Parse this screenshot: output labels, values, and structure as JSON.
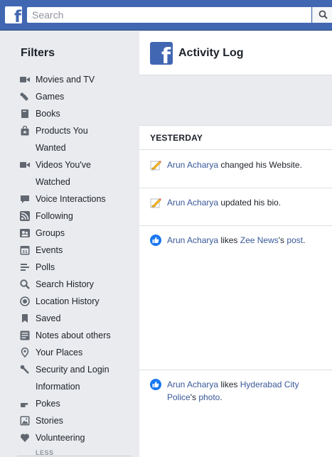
{
  "search": {
    "placeholder": "Search"
  },
  "sidebar": {
    "title": "Filters",
    "items": [
      {
        "label": "Movies and TV"
      },
      {
        "label": "Games"
      },
      {
        "label": "Books"
      },
      {
        "label": "Products You"
      },
      {
        "label": "Wanted"
      },
      {
        "label": "Videos You've"
      },
      {
        "label": "Watched"
      },
      {
        "label": "Voice Interactions"
      },
      {
        "label": "Following"
      },
      {
        "label": "Groups"
      },
      {
        "label": "Events"
      },
      {
        "label": "Polls"
      },
      {
        "label": "Search History"
      },
      {
        "label": "Location History"
      },
      {
        "label": "Saved"
      },
      {
        "label": "Notes about others"
      },
      {
        "label": "Your Places"
      },
      {
        "label": "Security and Login"
      },
      {
        "label": "Information"
      },
      {
        "label": "Pokes"
      },
      {
        "label": "Stories"
      },
      {
        "label": "Volunteering"
      }
    ],
    "less_label": "LESS"
  },
  "header": {
    "title": "Activity Log"
  },
  "feed": {
    "day_label": "YESTERDAY",
    "entries": [
      {
        "actor": "Arun Acharya",
        "action": " changed his Website."
      },
      {
        "actor": "Arun Acharya",
        "action": " updated his bio."
      },
      {
        "actor": "Arun Acharya",
        "mid": " likes ",
        "target": "Zee News",
        "poss": "'s ",
        "object": "post",
        "end": "."
      },
      {
        "actor": "Arun Acharya",
        "mid": " likes ",
        "target": "Hyderabad City Police",
        "poss": "'s ",
        "object": "photo",
        "end": "."
      }
    ]
  },
  "colors": {
    "brand": "#4267b2",
    "link": "#385898",
    "like": "#1877f2"
  }
}
